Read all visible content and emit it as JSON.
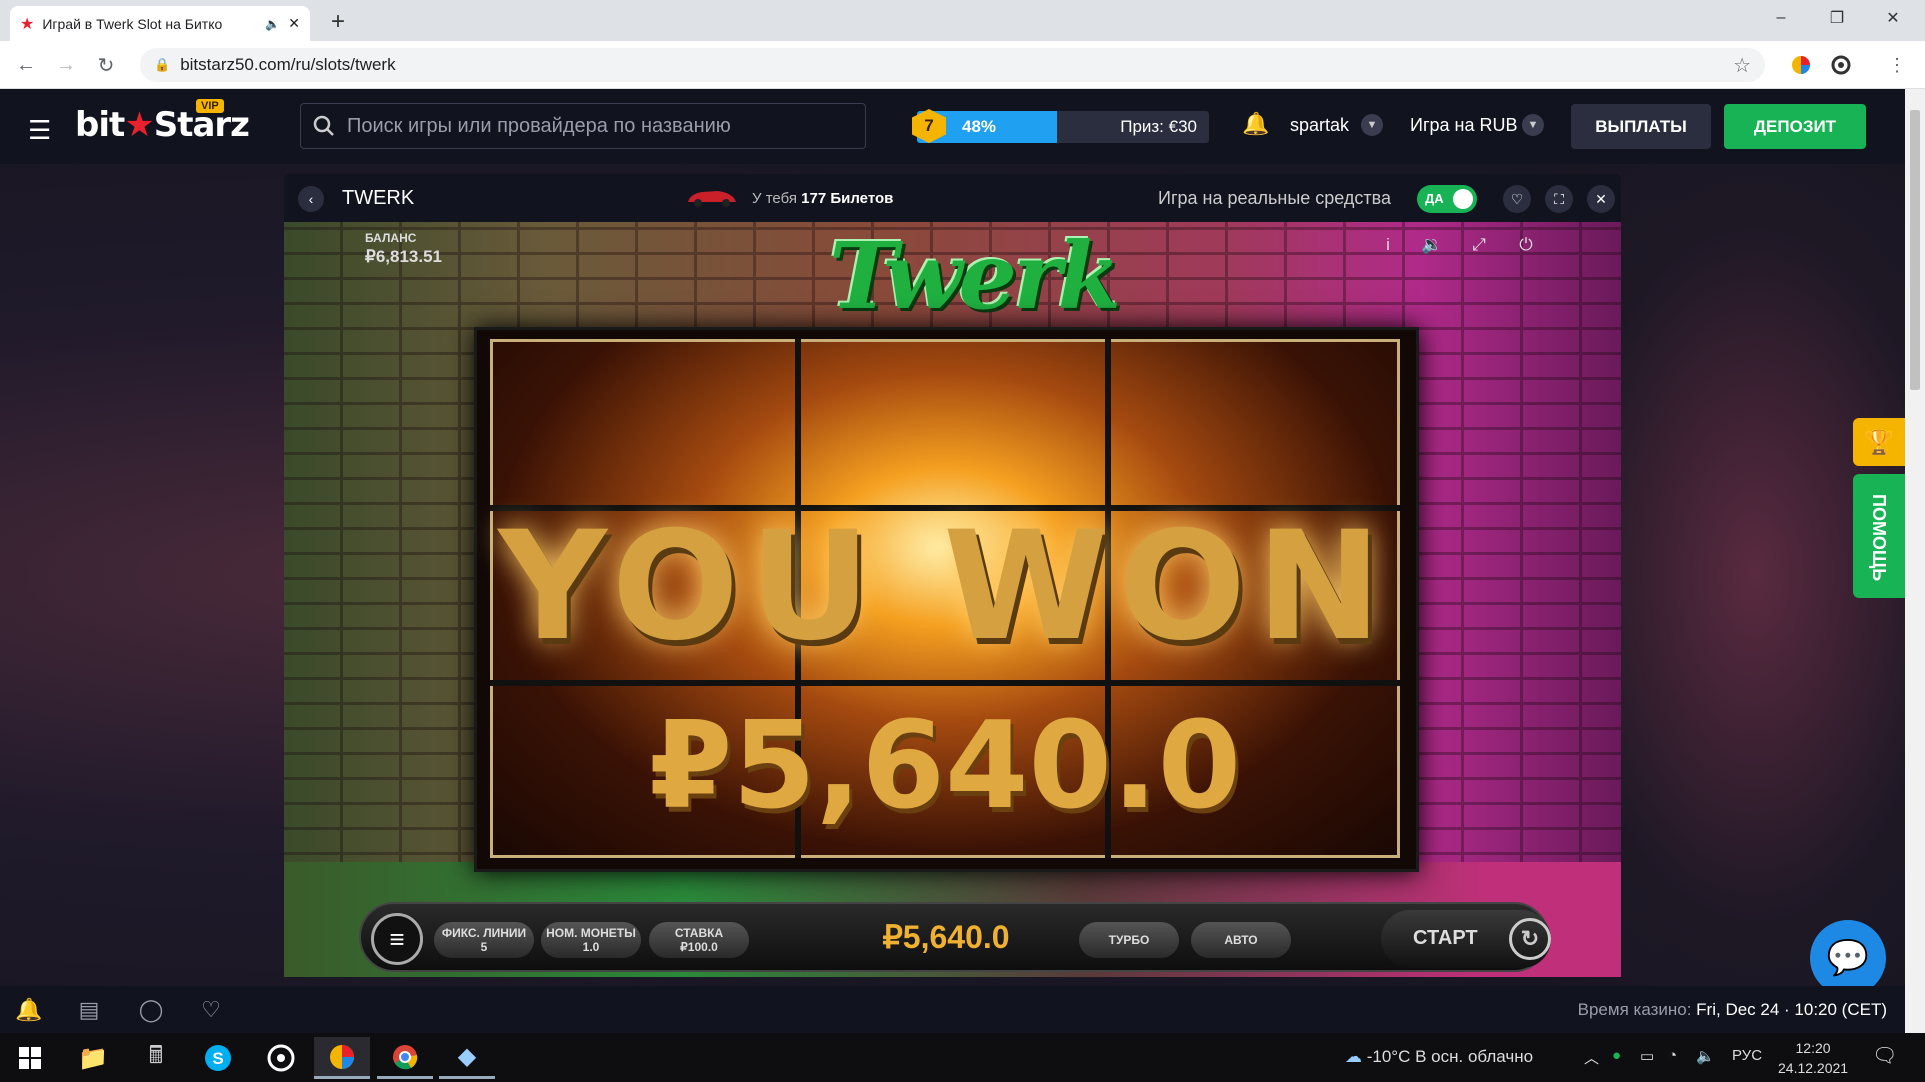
{
  "browser": {
    "tab_title": "Играй в Twerk Slot на Битко",
    "new_tab": "+",
    "url": "bitstarz50.com/ru/slots/twerk",
    "win_min": "–",
    "win_max": "❐",
    "win_close": "✕"
  },
  "header": {
    "logo_bit": "bit",
    "logo_star": "★",
    "logo_starz": "Starz",
    "vip": "VIP",
    "search_placeholder": "Поиск игры или провайдера по названию",
    "level": "7",
    "progress_label": "48%",
    "progress_value": 0.48,
    "prize": "Приз: €30",
    "username": "spartak",
    "currency": "Игра на RUB",
    "payouts": "ВЫПЛАТЫ",
    "deposit": "ДЕПОЗИТ"
  },
  "game_header": {
    "title": "TWERK",
    "tickets_prefix": "У тебя",
    "tickets_count": "177 Билетов",
    "real_money": "Игра на реальные средства",
    "toggle_label": "ДА"
  },
  "game": {
    "balance_label": "БАЛАНС",
    "balance_value": "₽6,813.51",
    "logo": "Twerk",
    "you_won": "YOU WON",
    "win_amount": "₽5,640.0",
    "controls": {
      "lines_label": "ФИКС. ЛИНИИ",
      "lines_value": "5",
      "coin_label": "НОМ. МОНЕТЫ",
      "coin_value": "1.0",
      "bet_label": "СТАВКА",
      "bet_value": "₽100.0",
      "win_display": "₽5,640.0",
      "turbo": "ТУРБО",
      "auto": "АВТО",
      "start": "СТАРТ"
    }
  },
  "side": {
    "help": "ПОМОЩЬ"
  },
  "footer": {
    "casino_time_label": "Время казино:",
    "casino_time_value": "Fri, Dec 24 · 10:20 (CET)"
  },
  "taskbar": {
    "weather": "-10°C  В осн. облачно",
    "lang": "РУС",
    "time": "12:20",
    "date": "24.12.2021"
  },
  "colors": {
    "accent_green": "#17b355",
    "accent_gold": "#f5b400",
    "progress_blue": "#20a0f0"
  }
}
